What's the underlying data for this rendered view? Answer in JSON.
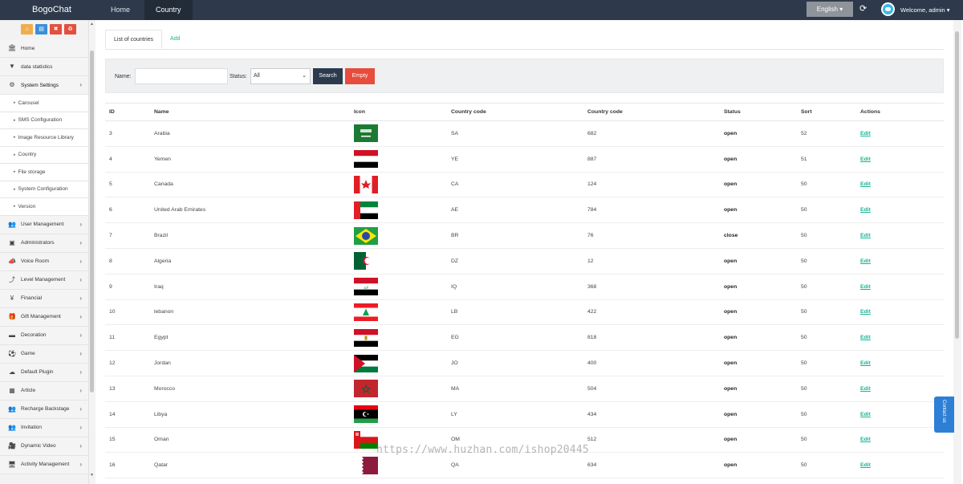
{
  "app": {
    "brand": "BogoChat",
    "top_nav": [
      {
        "label": "Home"
      },
      {
        "label": "Country"
      }
    ],
    "language_label": "English ▾",
    "welcome_label": "Welcome, admin ▾"
  },
  "sidebar": {
    "menu": [
      {
        "label": "Home",
        "icon": "bank-icon"
      },
      {
        "label": "data statistics",
        "icon": "filter-icon"
      },
      {
        "label": "System Settings",
        "icon": "cogs-icon",
        "open": true
      }
    ],
    "submenu": [
      {
        "label": "Carousel"
      },
      {
        "label": "SMS Configuration"
      },
      {
        "label": "Image Resource Library"
      },
      {
        "label": "Country"
      },
      {
        "label": "File storage"
      },
      {
        "label": "System Configuration"
      },
      {
        "label": "Version"
      }
    ],
    "menu2": [
      {
        "label": "User Management",
        "icon": "users-icon"
      },
      {
        "label": "Administrators",
        "icon": "id-card-icon"
      },
      {
        "label": "Voice Room",
        "icon": "bullhorn-icon"
      },
      {
        "label": "Level Management",
        "icon": "level-icon"
      },
      {
        "label": "Financial",
        "icon": "yen-icon"
      },
      {
        "label": "Gift Management",
        "icon": "gift-icon"
      },
      {
        "label": "Decoration",
        "icon": "minus-icon"
      },
      {
        "label": "Game",
        "icon": "soccer-icon"
      },
      {
        "label": "Default Plugin",
        "icon": "cloud-icon"
      },
      {
        "label": "Article",
        "icon": "grid-icon"
      },
      {
        "label": "Recharge Backstage",
        "icon": "users-icon"
      },
      {
        "label": "Invitation",
        "icon": "users-icon"
      },
      {
        "label": "Dynamic Video",
        "icon": "video-icon"
      },
      {
        "label": "Activity Management",
        "icon": "desktop-icon"
      }
    ]
  },
  "tabs": [
    {
      "label": "List of countries"
    },
    {
      "label": "Add"
    }
  ],
  "filter": {
    "name_label": "Name:",
    "name_value": "",
    "status_label": "Status:",
    "status_value": "All",
    "search_label": "Search",
    "empty_label": "Empty"
  },
  "table": {
    "columns": [
      "ID",
      "Name",
      "Icon",
      "Country code",
      "Country code",
      "Status",
      "Sort",
      "Actions"
    ],
    "rows": [
      {
        "id": "3",
        "name": "Arabia",
        "flag": "sa-flag",
        "code": "SA",
        "dial": "682",
        "status": "open",
        "sort": "52",
        "action": "Edit"
      },
      {
        "id": "4",
        "name": "Yemen",
        "flag": "ye-flag",
        "code": "YE",
        "dial": "887",
        "status": "open",
        "sort": "51",
        "action": "Edit"
      },
      {
        "id": "5",
        "name": "Canada",
        "flag": "ca-flag",
        "code": "CA",
        "dial": "124",
        "status": "open",
        "sort": "50",
        "action": "Edit"
      },
      {
        "id": "6",
        "name": "United Arab Emirates",
        "flag": "ae-flag",
        "code": "AE",
        "dial": "784",
        "status": "open",
        "sort": "50",
        "action": "Edit"
      },
      {
        "id": "7",
        "name": "Brazil",
        "flag": "br-flag",
        "code": "BR",
        "dial": "76",
        "status": "close",
        "sort": "50",
        "action": "Edit"
      },
      {
        "id": "8",
        "name": "Algeria",
        "flag": "dz-flag",
        "code": "DZ",
        "dial": "12",
        "status": "open",
        "sort": "50",
        "action": "Edit"
      },
      {
        "id": "9",
        "name": "Iraq",
        "flag": "iq-flag",
        "code": "IQ",
        "dial": "368",
        "status": "open",
        "sort": "50",
        "action": "Edit"
      },
      {
        "id": "10",
        "name": "lebanon",
        "flag": "lb-flag",
        "code": "LB",
        "dial": "422",
        "status": "open",
        "sort": "50",
        "action": "Edit"
      },
      {
        "id": "11",
        "name": "Egypt",
        "flag": "eg-flag",
        "code": "EG",
        "dial": "818",
        "status": "open",
        "sort": "50",
        "action": "Edit"
      },
      {
        "id": "12",
        "name": "Jordan",
        "flag": "jo-flag",
        "code": "JO",
        "dial": "400",
        "status": "open",
        "sort": "50",
        "action": "Edit"
      },
      {
        "id": "13",
        "name": "Morocco",
        "flag": "ma-flag",
        "code": "MA",
        "dial": "504",
        "status": "open",
        "sort": "50",
        "action": "Edit"
      },
      {
        "id": "14",
        "name": "Libya",
        "flag": "ly-flag",
        "code": "LY",
        "dial": "434",
        "status": "open",
        "sort": "50",
        "action": "Edit"
      },
      {
        "id": "15",
        "name": "Oman",
        "flag": "om-flag",
        "code": "OM",
        "dial": "512",
        "status": "open",
        "sort": "50",
        "action": "Edit"
      },
      {
        "id": "16",
        "name": "Qatar",
        "flag": "qa-flag",
        "code": "QA",
        "dial": "634",
        "status": "open",
        "sort": "50",
        "action": "Edit"
      }
    ]
  },
  "contact_label": "Contact us",
  "watermark": "https://www.huzhan.com/ishop20445"
}
